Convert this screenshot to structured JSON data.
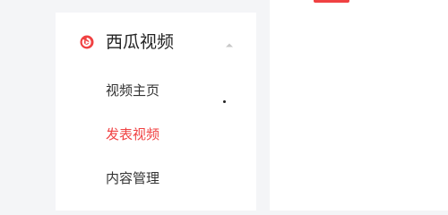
{
  "sidebar": {
    "section": {
      "title": "西瓜视频",
      "icon": "xigua-logo-icon",
      "expanded": true,
      "collapse_icon": "chevron-up-icon"
    },
    "items": [
      {
        "label": "视频主页",
        "active": false
      },
      {
        "label": "发表视频",
        "active": true
      },
      {
        "label": "内容管理",
        "active": false
      }
    ]
  },
  "colors": {
    "accent": "#f04142",
    "text": "#333333",
    "background": "#f4f5f7",
    "panel": "#ffffff"
  }
}
